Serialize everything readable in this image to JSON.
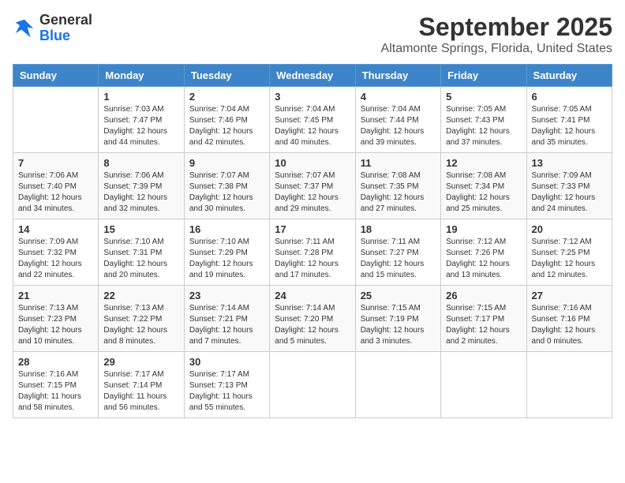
{
  "header": {
    "logo": {
      "line1": "General",
      "line2": "Blue"
    },
    "month": "September 2025",
    "location": "Altamonte Springs, Florida, United States"
  },
  "calendar": {
    "weekdays": [
      "Sunday",
      "Monday",
      "Tuesday",
      "Wednesday",
      "Thursday",
      "Friday",
      "Saturday"
    ],
    "weeks": [
      [
        {
          "day": "",
          "info": ""
        },
        {
          "day": "1",
          "info": "Sunrise: 7:03 AM\nSunset: 7:47 PM\nDaylight: 12 hours\nand 44 minutes."
        },
        {
          "day": "2",
          "info": "Sunrise: 7:04 AM\nSunset: 7:46 PM\nDaylight: 12 hours\nand 42 minutes."
        },
        {
          "day": "3",
          "info": "Sunrise: 7:04 AM\nSunset: 7:45 PM\nDaylight: 12 hours\nand 40 minutes."
        },
        {
          "day": "4",
          "info": "Sunrise: 7:04 AM\nSunset: 7:44 PM\nDaylight: 12 hours\nand 39 minutes."
        },
        {
          "day": "5",
          "info": "Sunrise: 7:05 AM\nSunset: 7:43 PM\nDaylight: 12 hours\nand 37 minutes."
        },
        {
          "day": "6",
          "info": "Sunrise: 7:05 AM\nSunset: 7:41 PM\nDaylight: 12 hours\nand 35 minutes."
        }
      ],
      [
        {
          "day": "7",
          "info": "Sunrise: 7:06 AM\nSunset: 7:40 PM\nDaylight: 12 hours\nand 34 minutes."
        },
        {
          "day": "8",
          "info": "Sunrise: 7:06 AM\nSunset: 7:39 PM\nDaylight: 12 hours\nand 32 minutes."
        },
        {
          "day": "9",
          "info": "Sunrise: 7:07 AM\nSunset: 7:38 PM\nDaylight: 12 hours\nand 30 minutes."
        },
        {
          "day": "10",
          "info": "Sunrise: 7:07 AM\nSunset: 7:37 PM\nDaylight: 12 hours\nand 29 minutes."
        },
        {
          "day": "11",
          "info": "Sunrise: 7:08 AM\nSunset: 7:35 PM\nDaylight: 12 hours\nand 27 minutes."
        },
        {
          "day": "12",
          "info": "Sunrise: 7:08 AM\nSunset: 7:34 PM\nDaylight: 12 hours\nand 25 minutes."
        },
        {
          "day": "13",
          "info": "Sunrise: 7:09 AM\nSunset: 7:33 PM\nDaylight: 12 hours\nand 24 minutes."
        }
      ],
      [
        {
          "day": "14",
          "info": "Sunrise: 7:09 AM\nSunset: 7:32 PM\nDaylight: 12 hours\nand 22 minutes."
        },
        {
          "day": "15",
          "info": "Sunrise: 7:10 AM\nSunset: 7:31 PM\nDaylight: 12 hours\nand 20 minutes."
        },
        {
          "day": "16",
          "info": "Sunrise: 7:10 AM\nSunset: 7:29 PM\nDaylight: 12 hours\nand 19 minutes."
        },
        {
          "day": "17",
          "info": "Sunrise: 7:11 AM\nSunset: 7:28 PM\nDaylight: 12 hours\nand 17 minutes."
        },
        {
          "day": "18",
          "info": "Sunrise: 7:11 AM\nSunset: 7:27 PM\nDaylight: 12 hours\nand 15 minutes."
        },
        {
          "day": "19",
          "info": "Sunrise: 7:12 AM\nSunset: 7:26 PM\nDaylight: 12 hours\nand 13 minutes."
        },
        {
          "day": "20",
          "info": "Sunrise: 7:12 AM\nSunset: 7:25 PM\nDaylight: 12 hours\nand 12 minutes."
        }
      ],
      [
        {
          "day": "21",
          "info": "Sunrise: 7:13 AM\nSunset: 7:23 PM\nDaylight: 12 hours\nand 10 minutes."
        },
        {
          "day": "22",
          "info": "Sunrise: 7:13 AM\nSunset: 7:22 PM\nDaylight: 12 hours\nand 8 minutes."
        },
        {
          "day": "23",
          "info": "Sunrise: 7:14 AM\nSunset: 7:21 PM\nDaylight: 12 hours\nand 7 minutes."
        },
        {
          "day": "24",
          "info": "Sunrise: 7:14 AM\nSunset: 7:20 PM\nDaylight: 12 hours\nand 5 minutes."
        },
        {
          "day": "25",
          "info": "Sunrise: 7:15 AM\nSunset: 7:19 PM\nDaylight: 12 hours\nand 3 minutes."
        },
        {
          "day": "26",
          "info": "Sunrise: 7:15 AM\nSunset: 7:17 PM\nDaylight: 12 hours\nand 2 minutes."
        },
        {
          "day": "27",
          "info": "Sunrise: 7:16 AM\nSunset: 7:16 PM\nDaylight: 12 hours\nand 0 minutes."
        }
      ],
      [
        {
          "day": "28",
          "info": "Sunrise: 7:16 AM\nSunset: 7:15 PM\nDaylight: 11 hours\nand 58 minutes."
        },
        {
          "day": "29",
          "info": "Sunrise: 7:17 AM\nSunset: 7:14 PM\nDaylight: 11 hours\nand 56 minutes."
        },
        {
          "day": "30",
          "info": "Sunrise: 7:17 AM\nSunset: 7:13 PM\nDaylight: 11 hours\nand 55 minutes."
        },
        {
          "day": "",
          "info": ""
        },
        {
          "day": "",
          "info": ""
        },
        {
          "day": "",
          "info": ""
        },
        {
          "day": "",
          "info": ""
        }
      ]
    ]
  }
}
